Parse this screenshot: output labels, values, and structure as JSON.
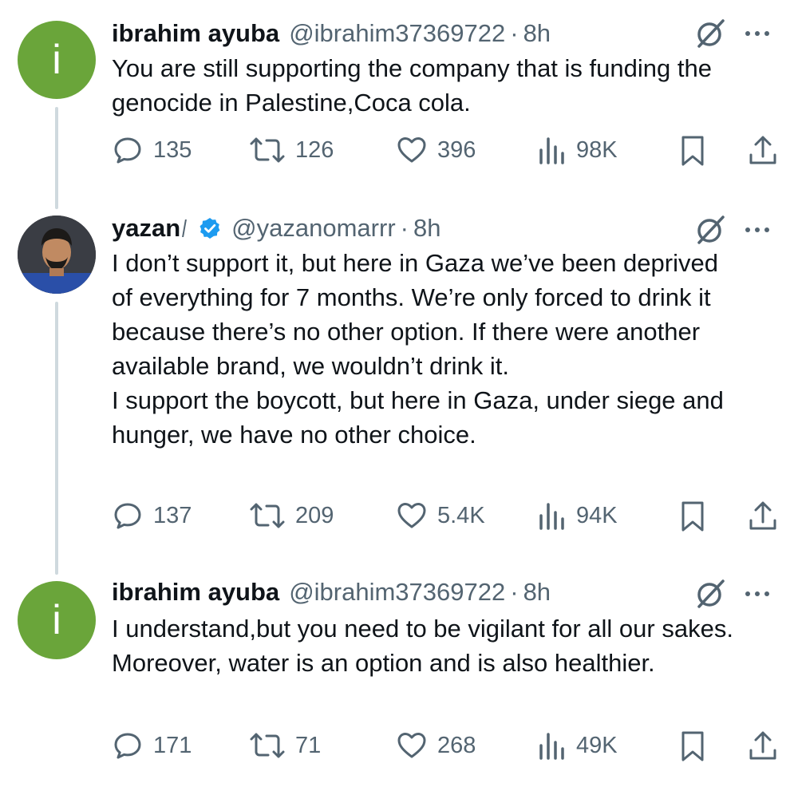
{
  "tweets": [
    {
      "name": "ibrahim ayuba",
      "handle": "@ibrahim37369722",
      "separator": "·",
      "time": "8h",
      "avatar_letter": "i",
      "lines": [
        "You are still supporting the company that is funding the genocide in Palestine,Coca cola."
      ],
      "replies": "135",
      "reposts": "126",
      "likes": "396",
      "views": "98K"
    },
    {
      "name": "yazan",
      "handle": "@yazanomarrr",
      "separator": "·",
      "time": "8h",
      "verified": true,
      "lines": [
        "I don’t support it, but here in Gaza we’ve been deprived of everything for 7 months. We’re only forced to drink it because there’s no other option. If there were another available brand, we wouldn’t drink it.",
        "I support the boycott, but here in Gaza, under siege and hunger, we have no other choice."
      ],
      "replies": "137",
      "reposts": "209",
      "likes": "5.4K",
      "views": "94K"
    },
    {
      "name": "ibrahim ayuba",
      "handle": "@ibrahim37369722",
      "separator": "·",
      "time": "8h",
      "avatar_letter": "i",
      "lines": [
        "I understand,but you need to be vigilant for all our sakes. Moreover, water is an option and is also healthier."
      ],
      "replies": "171",
      "reposts": "71",
      "likes": "268",
      "views": "49K"
    }
  ],
  "colors": {
    "text": "#0f1419",
    "muted": "#536471",
    "avatar_green": "#6aa53a",
    "verified_blue": "#1d9bf0",
    "thread_line": "#cfd9de"
  },
  "icons": [
    "reply-icon",
    "repost-icon",
    "like-icon",
    "views-icon",
    "bookmark-icon",
    "share-icon",
    "grok-icon",
    "more-icon",
    "verified-icon"
  ]
}
